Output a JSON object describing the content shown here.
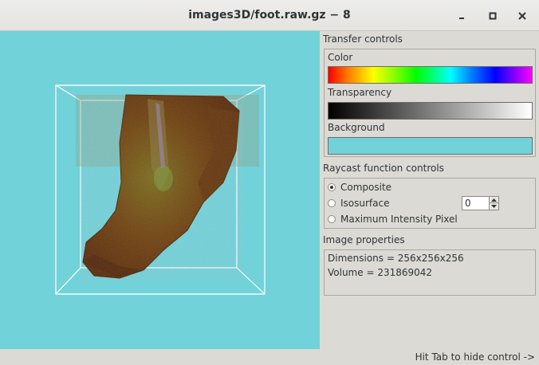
{
  "window": {
    "title": "images3D/foot.raw.gz − 8"
  },
  "titlebar_buttons": [
    "minimize-icon",
    "maximize-icon",
    "close-icon"
  ],
  "viewport": {
    "background_color": "#72d2d9",
    "bounding_box_color": "#ffffff"
  },
  "transfer": {
    "heading": "Transfer controls",
    "color_label": "Color",
    "transparency_label": "Transparency",
    "background_label": "Background",
    "background_swatch": "#72d2d9"
  },
  "raycast": {
    "heading": "Raycast function controls",
    "options": [
      "Composite",
      "Isosurface",
      "Maximum Intensity Pixel"
    ],
    "selected": "Composite",
    "isosurface_value": "0"
  },
  "image_properties": {
    "heading": "Image properties",
    "dimensions": "Dimensions = 256x256x256",
    "volume": "Volume = 231869042"
  },
  "status": {
    "hint": "Hit Tab to hide control ->"
  }
}
